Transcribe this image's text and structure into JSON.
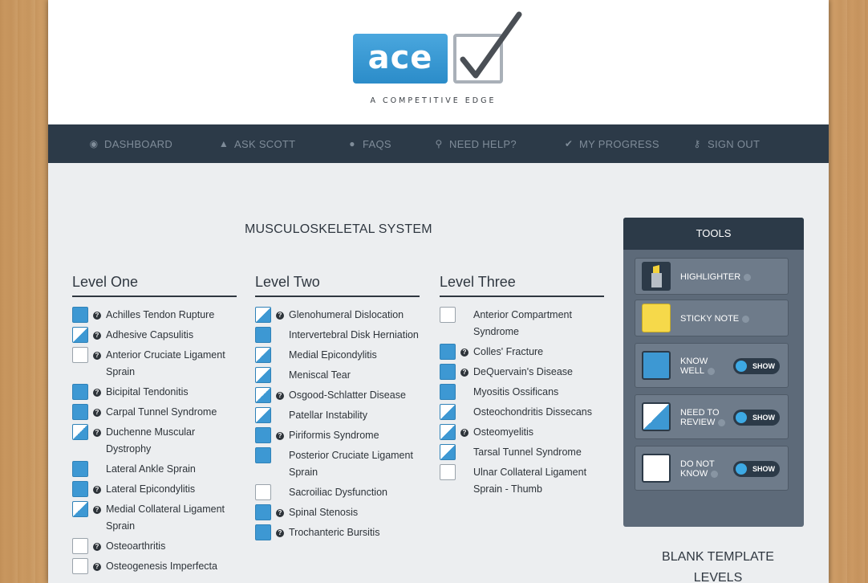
{
  "logo": {
    "word": "ace",
    "tagline": "A COMPETITIVE EDGE"
  },
  "nav": [
    {
      "label": "DASHBOARD",
      "icon": "dashboard-icon",
      "glyph": "◉"
    },
    {
      "label": "ASK SCOTT",
      "icon": "person-icon",
      "glyph": "▲"
    },
    {
      "label": "FAQS",
      "icon": "chat-icon",
      "glyph": "●"
    },
    {
      "label": "NEED HELP?",
      "icon": "search-icon",
      "glyph": "⚲"
    },
    {
      "label": "MY PROGRESS",
      "icon": "check-icon",
      "glyph": "✔"
    },
    {
      "label": "SIGN OUT",
      "icon": "key-icon",
      "glyph": "⚷"
    }
  ],
  "section_title": "MUSCULOSKELETAL SYSTEM",
  "columns": [
    {
      "title": "Level One",
      "items": [
        {
          "label": "Achilles Tendon Rupture",
          "state": "know",
          "info": true
        },
        {
          "label": "Adhesive Capsulitis",
          "state": "review",
          "info": true
        },
        {
          "label": "Anterior Cruciate Ligament Sprain",
          "state": "none",
          "info": true
        },
        {
          "label": "Bicipital Tendonitis",
          "state": "know",
          "info": true
        },
        {
          "label": "Carpal Tunnel Syndrome",
          "state": "know",
          "info": true
        },
        {
          "label": "Duchenne Muscular Dystrophy",
          "state": "review",
          "info": true
        },
        {
          "label": "Lateral Ankle Sprain",
          "state": "know",
          "info": false
        },
        {
          "label": "Lateral Epicondylitis",
          "state": "know",
          "info": true
        },
        {
          "label": "Medial Collateral Ligament Sprain",
          "state": "review",
          "info": true
        },
        {
          "label": "Osteoarthritis",
          "state": "none",
          "info": true
        },
        {
          "label": "Osteogenesis Imperfecta",
          "state": "none",
          "info": true
        }
      ]
    },
    {
      "title": "Level Two",
      "items": [
        {
          "label": "Glenohumeral Dislocation",
          "state": "review",
          "info": true
        },
        {
          "label": "Intervertebral Disk Herniation",
          "state": "know",
          "info": false
        },
        {
          "label": "Medial Epicondylitis",
          "state": "review",
          "info": false
        },
        {
          "label": "Meniscal Tear",
          "state": "review",
          "info": false
        },
        {
          "label": "Osgood-Schlatter Disease",
          "state": "review",
          "info": true
        },
        {
          "label": "Patellar Instability",
          "state": "review",
          "info": false
        },
        {
          "label": "Piriformis Syndrome",
          "state": "know",
          "info": true
        },
        {
          "label": "Posterior Cruciate Ligament Sprain",
          "state": "know",
          "info": false
        },
        {
          "label": "Sacroiliac Dysfunction",
          "state": "none",
          "info": false
        },
        {
          "label": "Spinal Stenosis",
          "state": "know",
          "info": true
        },
        {
          "label": "Trochanteric Bursitis",
          "state": "know",
          "info": true
        }
      ]
    },
    {
      "title": "Level Three",
      "items": [
        {
          "label": "Anterior Compartment Syndrome",
          "state": "none",
          "info": false
        },
        {
          "label": "Colles' Fracture",
          "state": "know",
          "info": true
        },
        {
          "label": "DeQuervain's Disease",
          "state": "know",
          "info": true
        },
        {
          "label": "Myositis Ossificans",
          "state": "know",
          "info": false
        },
        {
          "label": "Osteochondritis Dissecans",
          "state": "review",
          "info": false
        },
        {
          "label": "Osteomyelitis",
          "state": "review",
          "info": true
        },
        {
          "label": "Tarsal Tunnel Syndrome",
          "state": "review",
          "info": false
        },
        {
          "label": "Ulnar Collateral Ligament Sprain - Thumb",
          "state": "none",
          "info": false
        }
      ]
    }
  ],
  "tools": {
    "title": "TOOLS",
    "highlighter": "HIGHLIGHTER",
    "sticky": "STICKY NOTE",
    "know_well": "KNOW WELL",
    "need_review": "NEED TO REVIEW",
    "do_not_know": "DO NOT KNOW",
    "show": "SHOW"
  },
  "blank_template": "BLANK TEMPLATE LEVELS",
  "colors": {
    "nav_bg": "#2c3a48",
    "know": "#3d98d3",
    "tools_bg": "#5d6a79"
  }
}
